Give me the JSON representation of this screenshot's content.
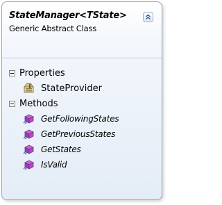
{
  "class": {
    "title": "StateManager<TState>",
    "subtitle": "Generic Abstract Class"
  },
  "sections": {
    "properties": {
      "label": "Properties",
      "items": [
        {
          "name": "StateProvider",
          "icon": "property-icon"
        }
      ]
    },
    "methods": {
      "label": "Methods",
      "items": [
        {
          "name": "GetFollowingStates",
          "icon": "method-icon"
        },
        {
          "name": "GetPreviousStates",
          "icon": "method-icon"
        },
        {
          "name": "GetStates",
          "icon": "method-icon"
        },
        {
          "name": "IsValid",
          "icon": "method-icon"
        }
      ]
    }
  },
  "colors": {
    "border": "#8fa6c7",
    "method_icon": "#b03fc4"
  }
}
